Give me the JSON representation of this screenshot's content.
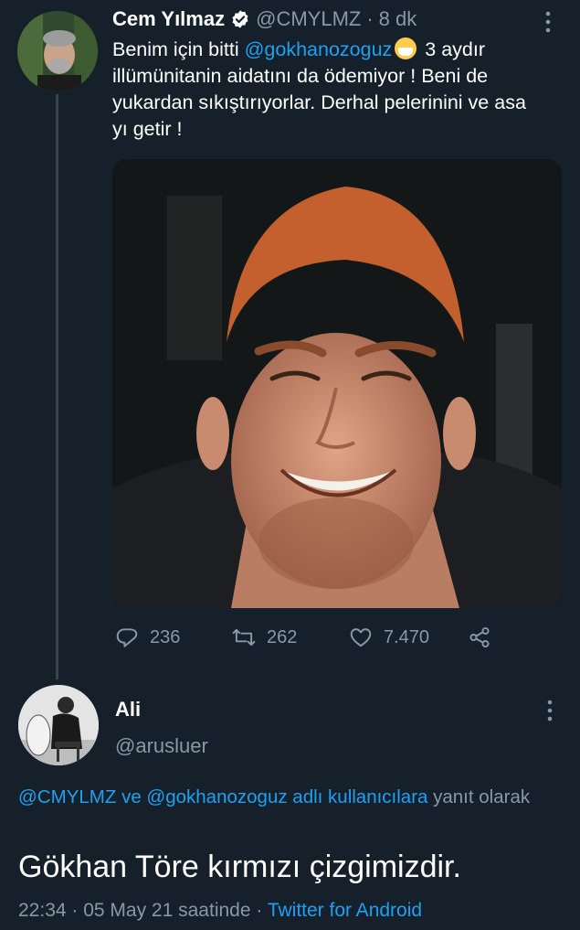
{
  "tweet": {
    "author": {
      "display_name": "Cem Yılmaz",
      "handle": "@CMYLMZ",
      "verified_icon": "verified-badge-icon"
    },
    "separator": "·",
    "time_ago": "8 dk",
    "text": {
      "part1": "Benim için bitti ",
      "mention": "@gokhanozoguz",
      "emoji": "face-with-medical-mask",
      "part2": " 3 aydır illümünitanin aidatını da ödemiyor ! Beni de yukardan sıkıştırıyorlar. Derhal pelerinini ve asa yı getir !"
    },
    "stats": {
      "replies": "236",
      "retweets": "262",
      "likes": "7.470"
    },
    "icons": [
      "reply-icon",
      "retweet-icon",
      "like-icon",
      "share-icon",
      "more-icon"
    ]
  },
  "reply": {
    "author": {
      "display_name": "Ali",
      "handle": "@arusluer"
    },
    "context": {
      "mention1": "@CMYLMZ",
      "and": " ve ",
      "mention2": "@gokhanozoguz",
      "suffix_link": " adlı kullanıcılara",
      "suffix": " yanıt olarak"
    },
    "text": "Gökhan Töre kırmızı çizgimizdir.",
    "meta": {
      "time": "22:34",
      "sep1": " · ",
      "date": "05 May 21 saatinde",
      "sep2": " · ",
      "source": "Twitter for Android"
    }
  },
  "colors": {
    "background": "#15202b",
    "accent": "#1da1f2",
    "muted": "#8899a6"
  }
}
